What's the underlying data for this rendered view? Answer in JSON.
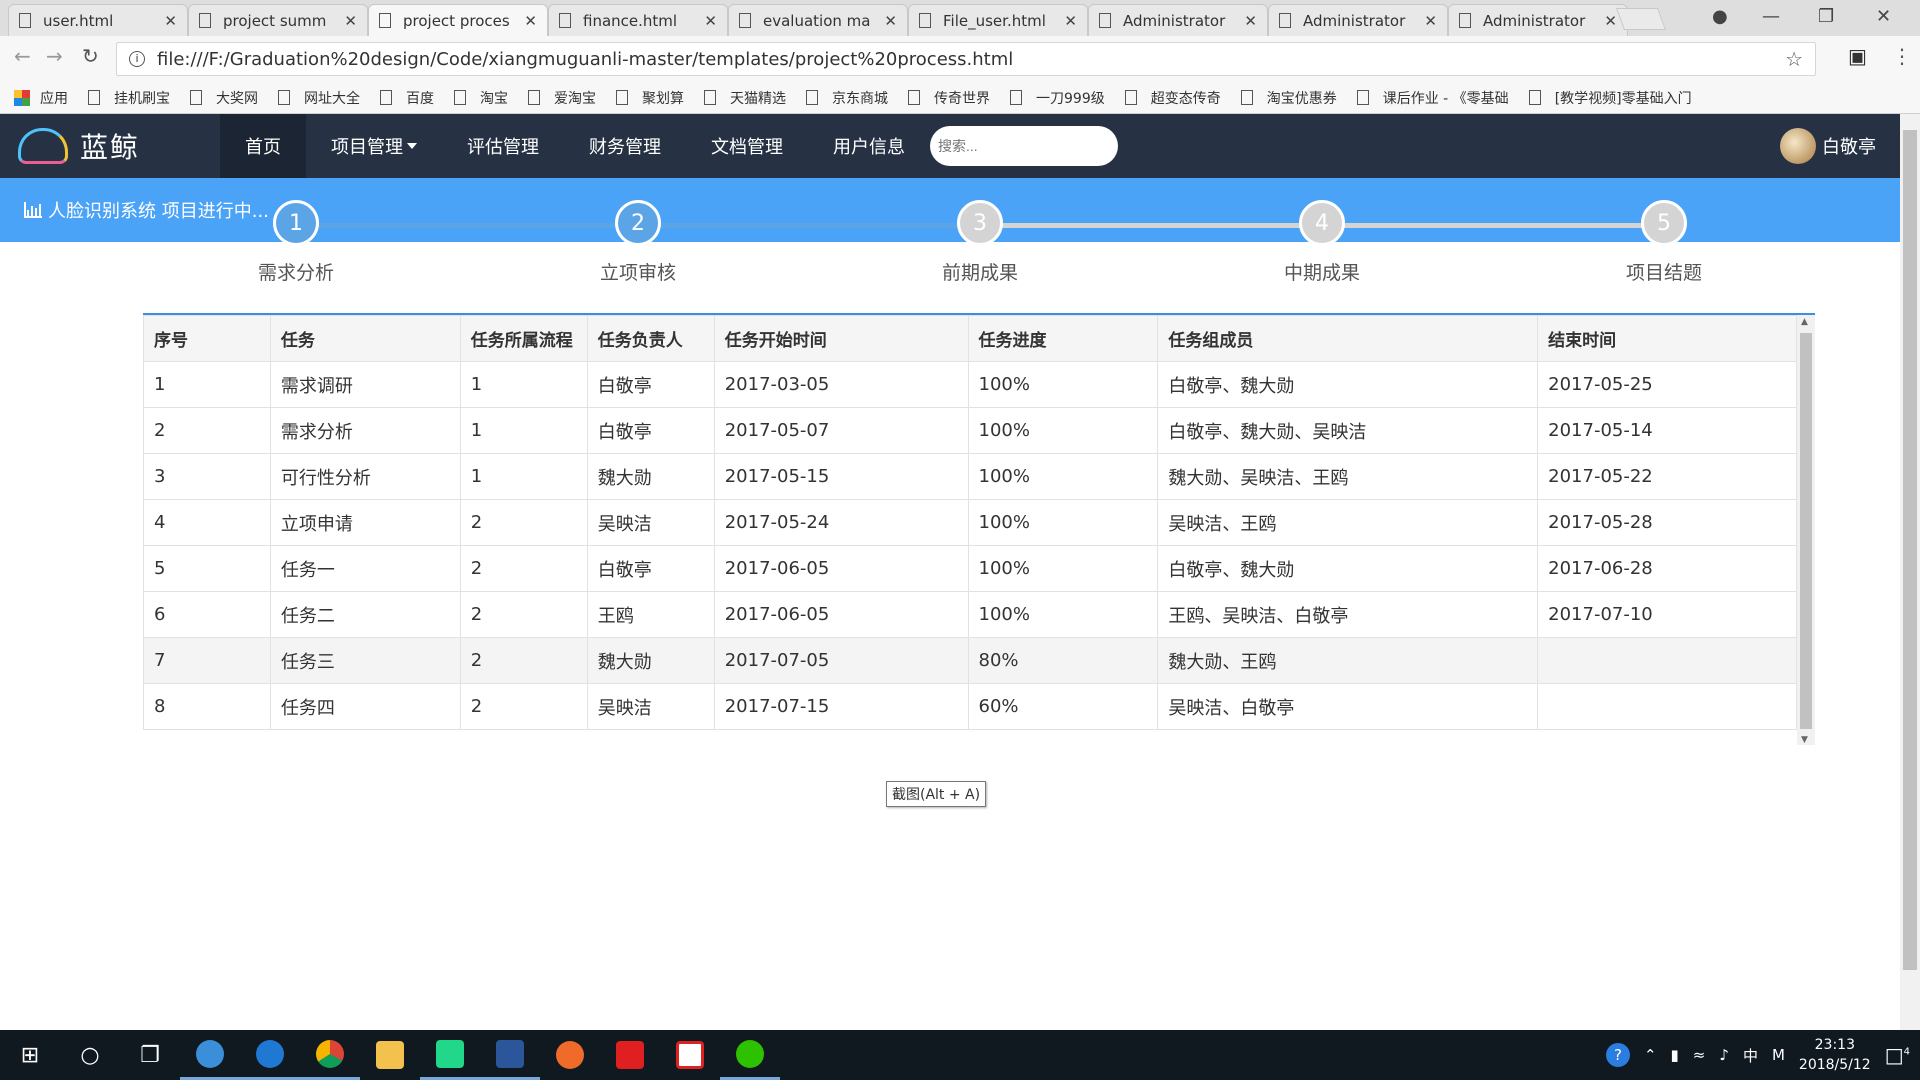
{
  "browser": {
    "tabs": [
      {
        "title": "user.html"
      },
      {
        "title": "project summ"
      },
      {
        "title": "project proces"
      },
      {
        "title": "finance.html"
      },
      {
        "title": "evaluation ma"
      },
      {
        "title": "File_user.html"
      },
      {
        "title": "Administrator"
      },
      {
        "title": "Administrator"
      },
      {
        "title": "Administrator"
      }
    ],
    "active_tab": 2,
    "url": "file:///F:/Graduation%20design/Code/xiangmuguanli-master/templates/project%20process.html",
    "bookmarks": [
      "应用",
      "挂机刷宝",
      "大奖网",
      "网址大全",
      "百度",
      "淘宝",
      "爱淘宝",
      "聚划算",
      "天猫精选",
      "京东商城",
      "传奇世界",
      "一刀999级",
      "超变态传奇",
      "淘宝优惠券",
      "课后作业 - 《零基础",
      "[教学视频]零基础入门"
    ]
  },
  "navbar": {
    "brand": "蓝鲸",
    "items": [
      {
        "label": "首页",
        "active": true
      },
      {
        "label": "项目管理",
        "dropdown": true
      },
      {
        "label": "评估管理"
      },
      {
        "label": "财务管理"
      },
      {
        "label": "文档管理"
      },
      {
        "label": "用户信息"
      }
    ],
    "search_placeholder": "搜索...",
    "user_name": "白敬亭"
  },
  "banner": {
    "text": "人脸识别系统 项目进行中..."
  },
  "steps": {
    "completed": 2,
    "progress_fraction": 0.5,
    "items": [
      {
        "num": "1",
        "label": "需求分析"
      },
      {
        "num": "2",
        "label": "立项审核"
      },
      {
        "num": "3",
        "label": "前期成果"
      },
      {
        "num": "4",
        "label": "中期成果"
      },
      {
        "num": "5",
        "label": "项目结题"
      }
    ],
    "colors": {
      "done": "#5ba4e6",
      "todo": "#d4d4d4"
    }
  },
  "table": {
    "headers": [
      "序号",
      "任务",
      "任务所属流程",
      "任务负责人",
      "任务开始时间",
      "任务进度",
      "任务组成员",
      "结束时间"
    ],
    "rows": [
      [
        "1",
        "需求调研",
        "1",
        "白敬亭",
        "2017-03-05",
        "100%",
        "白敬亭、魏大勋",
        "2017-05-25"
      ],
      [
        "2",
        "需求分析",
        "1",
        "白敬亭",
        "2017-05-07",
        "100%",
        "白敬亭、魏大勋、吴映洁",
        "2017-05-14"
      ],
      [
        "3",
        "可行性分析",
        "1",
        "魏大勋",
        "2017-05-15",
        "100%",
        "魏大勋、吴映洁、王鸥",
        "2017-05-22"
      ],
      [
        "4",
        "立项申请",
        "2",
        "吴映洁",
        "2017-05-24",
        "100%",
        "吴映洁、王鸥",
        "2017-05-28"
      ],
      [
        "5",
        "任务一",
        "2",
        "白敬亭",
        "2017-06-05",
        "100%",
        "白敬亭、魏大勋",
        "2017-06-28"
      ],
      [
        "6",
        "任务二",
        "2",
        "王鸥",
        "2017-06-05",
        "100%",
        "王鸥、吴映洁、白敬亭",
        "2017-07-10"
      ],
      [
        "7",
        "任务三",
        "2",
        "魏大勋",
        "2017-07-05",
        "80%",
        "魏大勋、王鸥",
        ""
      ],
      [
        "8",
        "任务四",
        "2",
        "吴映洁",
        "2017-07-15",
        "60%",
        "吴映洁、白敬亭",
        ""
      ]
    ]
  },
  "tooltip": "截图(Alt + A)",
  "taskbar": {
    "time": "23:13",
    "date": "2018/5/12",
    "ime": "中",
    "notifications": "4"
  }
}
